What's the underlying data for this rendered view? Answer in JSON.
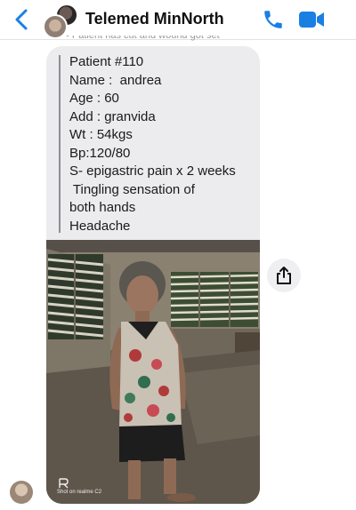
{
  "header": {
    "title": "Telemed MinNorth",
    "back_icon": "chevron-left-icon",
    "call_icon": "phone-icon",
    "video_icon": "video-camera-icon",
    "accent": "#1a7fe3"
  },
  "previous_message": {
    "fragment": "• Patient has cut and wound got set"
  },
  "message": {
    "lines": [
      "Patient #110",
      "Name :  andrea",
      "Age : 60",
      "Add : granvida",
      "Wt : 54kgs",
      "Bp:120/80",
      "S- epigastric pain x 2 weeks",
      " Tingling sensation of",
      "both hands",
      "Headache"
    ]
  },
  "photo": {
    "watermark_line1": "Shot on realme C2",
    "share_icon": "share-icon"
  }
}
